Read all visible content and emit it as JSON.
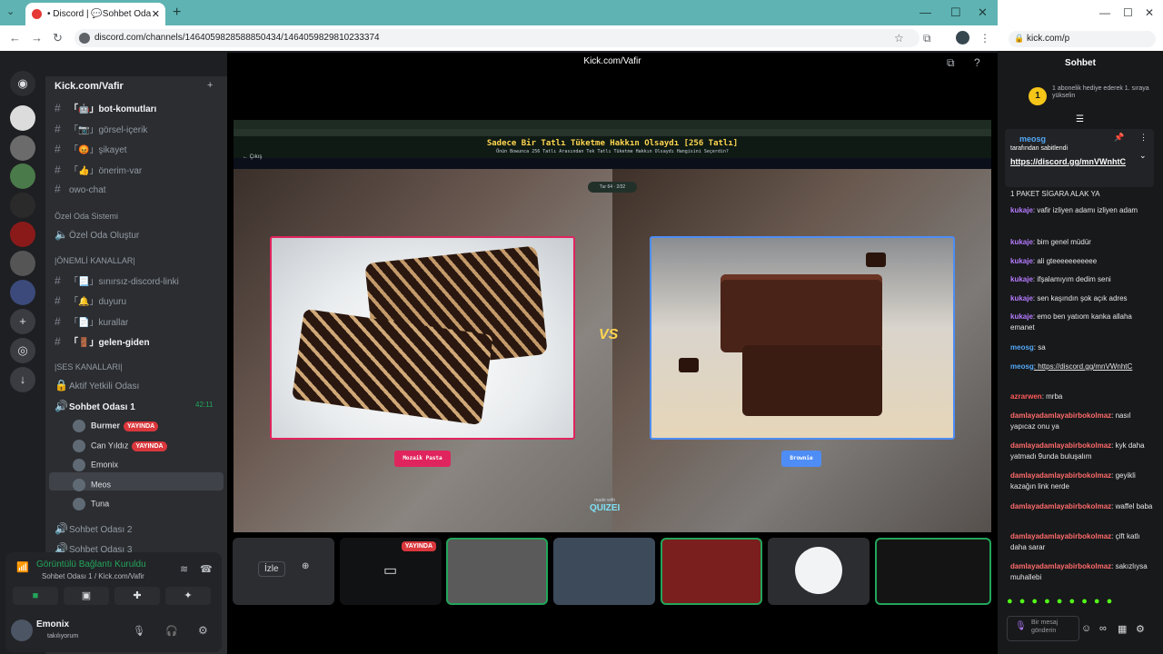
{
  "browser": {
    "tab_title": "• Discord | 💬Sohbet Oda",
    "url": "discord.com/channels/1464059828588850434/1464059829810233374"
  },
  "discord": {
    "server_name": "Kick.com/Vafir",
    "channels": [
      {
        "icon": "#",
        "label": "「🤖」bot-komutları",
        "bold": true
      },
      {
        "icon": "#",
        "label": "「📷」görsel-içerik",
        "bold": false
      },
      {
        "icon": "#",
        "label": "「😡」şikayet",
        "bold": false
      },
      {
        "icon": "#",
        "label": "「👍」önerim-var",
        "bold": false
      },
      {
        "icon": "#",
        "label": "owo-chat",
        "bold": false
      }
    ],
    "cat_private": "Özel Oda Sistemi",
    "create_room": "Özel Oda Oluştur",
    "cat_important": "|ÖNEMLİ KANALLAR|",
    "important": [
      {
        "icon": "#",
        "label": "「📃」sınırsız-discord-linki",
        "bold": false
      },
      {
        "icon": "#",
        "label": "「🔔」duyuru",
        "bold": false
      },
      {
        "icon": "#",
        "label": "「📄」kurallar",
        "bold": false
      },
      {
        "icon": "#",
        "label": "「🚪」gelen-giden",
        "bold": true
      }
    ],
    "cat_voice": "|SES KANALLARI|",
    "voice_locked": "Aktif Yetkili Odası",
    "voice_channel": "Sohbet Odası 1",
    "voice_time": "42:11",
    "voice_users": [
      {
        "name": "Burmer",
        "live": "YAYINDA"
      },
      {
        "name": "Can Yıldız",
        "live": "YAYINDA"
      },
      {
        "name": "Emonix",
        "live": ""
      },
      {
        "name": "Meos",
        "live": ""
      },
      {
        "name": "Tuna",
        "live": ""
      }
    ],
    "voice_channel_2": "Sohbet Odası 2",
    "voice_channel_3": "Sohbet Odası 3",
    "connection": "Görüntülü Bağlantı Kuruldu",
    "connection_sub": "Sohbet Odası 1 / Kick.com/Vafir",
    "user_name": "Emonix",
    "user_status": "takılıyorum"
  },
  "stream": {
    "title": "Kick.com/Vafir",
    "quiz_title": "Sadece Bir Tatlı Tüketme Hakkın Olsaydı [256 Tatlı]",
    "quiz_subtitle": "Önün Bowunca 256 Tatlı Arasından Tek Tatlı Tüketme Hakkın Olsaydı Hangisini Seçerdin?",
    "back": "← Çıkış",
    "step": "Tur 64 · 2/32",
    "left_label": "Mozaik Pasta",
    "right_label": "Brownie",
    "vs": "VS",
    "watermark": "QUIZEI",
    "watermark_sub": "made with",
    "watch": "İzle",
    "tile_live": "YAYINDA"
  },
  "kick": {
    "url": "kick.com/p",
    "chat_title": "Sohbet",
    "gift_count": "1",
    "gift_text": "1 abonelik hediye ederek 1. sıraya yükselin",
    "pinned_user": "meosg",
    "pinned_by": "tarafından sabitlendi",
    "pinned_link": "https://discord.gg/mnVWnhtC",
    "messages": [
      {
        "user": "",
        "text": "1 PAKET SİGARA ALAK YA",
        "color": "#e6e6e6"
      },
      {
        "user": "kukaje",
        "text": ": vafir izliyen adamı izliyen adam",
        "color": "#b57bff"
      },
      {
        "user": "kukaje",
        "text": ": bim genel müdür",
        "color": "#b57bff"
      },
      {
        "user": "kukaje",
        "text": ": ali gteeeeeeeeeee",
        "color": "#b57bff"
      },
      {
        "user": "kukaje",
        "text": ": ifşalamıyım dedim seni",
        "color": "#b57bff"
      },
      {
        "user": "kukaje",
        "text": ": sen kaşındın şok açık adres",
        "color": "#b57bff"
      },
      {
        "user": "kukaje",
        "text": ": emo ben yatıom kanka allaha emanet",
        "color": "#b57bff"
      },
      {
        "user": "meosg",
        "text": ": sa",
        "color": "#53a8f5"
      },
      {
        "user": "meosg",
        "text": ": https://discord.gg/mnVWnhtC",
        "color": "#53a8f5"
      },
      {
        "user": "azrarwen",
        "text": ": mrba",
        "color": "#ff5a5a"
      },
      {
        "user": "damlayadamlayabirbokolmaz",
        "text": ": nasıl yapıcaz onu ya",
        "color": "#ff6b6b"
      },
      {
        "user": "damlayadamlayabirbokolmaz",
        "text": ": kyk daha yatmadı 9unda buluşalım",
        "color": "#ff6b6b"
      },
      {
        "user": "damlayadamlayabirbokolmaz",
        "text": ": geyikli kazağın link nerde",
        "color": "#ff6b6b"
      },
      {
        "user": "damlayadamlayabirbokolmaz",
        "text": ": waffel baba",
        "color": "#ff6b6b"
      },
      {
        "user": "damlayadamlayabirbokolmaz",
        "text": ": çift katlı daha sarar",
        "color": "#ff6b6b"
      },
      {
        "user": "damlayadamlayabirbokolmaz",
        "text": ": sakızlıysa muhallebi",
        "color": "#ff6b6b"
      }
    ],
    "input_placeholder": "Bir mesaj gönderin"
  }
}
